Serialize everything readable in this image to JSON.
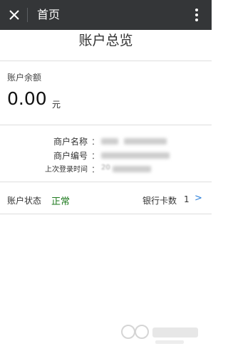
{
  "header": {
    "close_icon": "close-icon",
    "title": "首页",
    "menu_icon": "more-vertical-icon",
    "background": "#343638"
  },
  "page": {
    "title": "账户总览"
  },
  "balance": {
    "label": "账户余额",
    "amount": "0.00",
    "unit": "元"
  },
  "merchant": {
    "rows": [
      {
        "label": "商户名称",
        "colon": "：",
        "value": ""
      },
      {
        "label": "商户编号",
        "colon": "：",
        "value": ""
      },
      {
        "label": "上次登录时间",
        "colon": "：",
        "value": "20"
      }
    ]
  },
  "status": {
    "label": "账户状态",
    "value": "正常",
    "value_color": "#1e7a1e",
    "bankcard_label": "银行卡数",
    "bankcard_count": "1",
    "chevron": ">",
    "chevron_color": "#2b7fd9"
  }
}
